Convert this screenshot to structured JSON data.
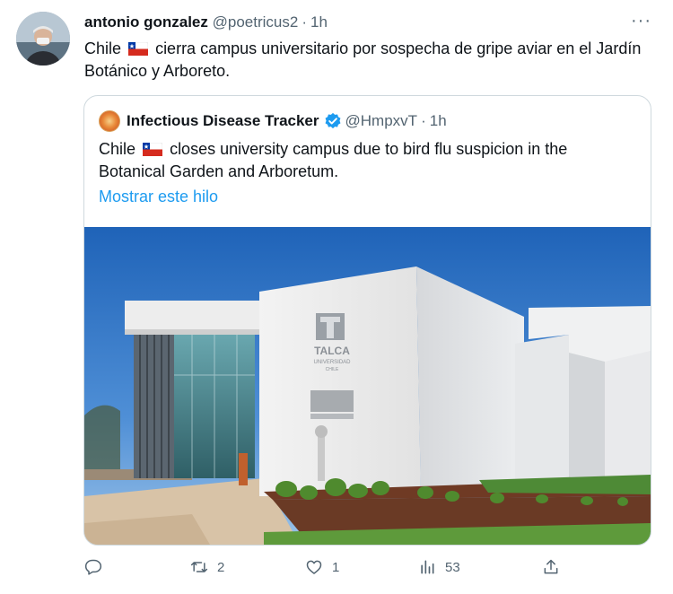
{
  "tweet": {
    "display_name": "antonio gonzalez",
    "handle": "@poetricus2",
    "time": "1h",
    "text_before_flag": "Chile",
    "text_after_flag": "cierra campus universitario por sospecha de gripe aviar en el Jardín Botánico y Arboreto.",
    "more_label": "···"
  },
  "quote": {
    "display_name": "Infectious Disease Tracker",
    "handle": "@HmpxvT",
    "time": "1h",
    "text_before_flag": "Chile",
    "text_after_flag": "closes university campus due to bird flu suspicion in the Botanical Garden and Arboretum.",
    "show_thread": "Mostrar este hilo",
    "photo_sign": {
      "line1": "TALCA",
      "line2": "UNIVERSIDAD",
      "line3": "CHILE"
    }
  },
  "actions": {
    "reply_count": "",
    "retweet_count": "2",
    "like_count": "1",
    "views_count": "53"
  },
  "colors": {
    "link": "#1d9bf0",
    "secondary_text": "#536471",
    "border": "#cfd9de"
  }
}
